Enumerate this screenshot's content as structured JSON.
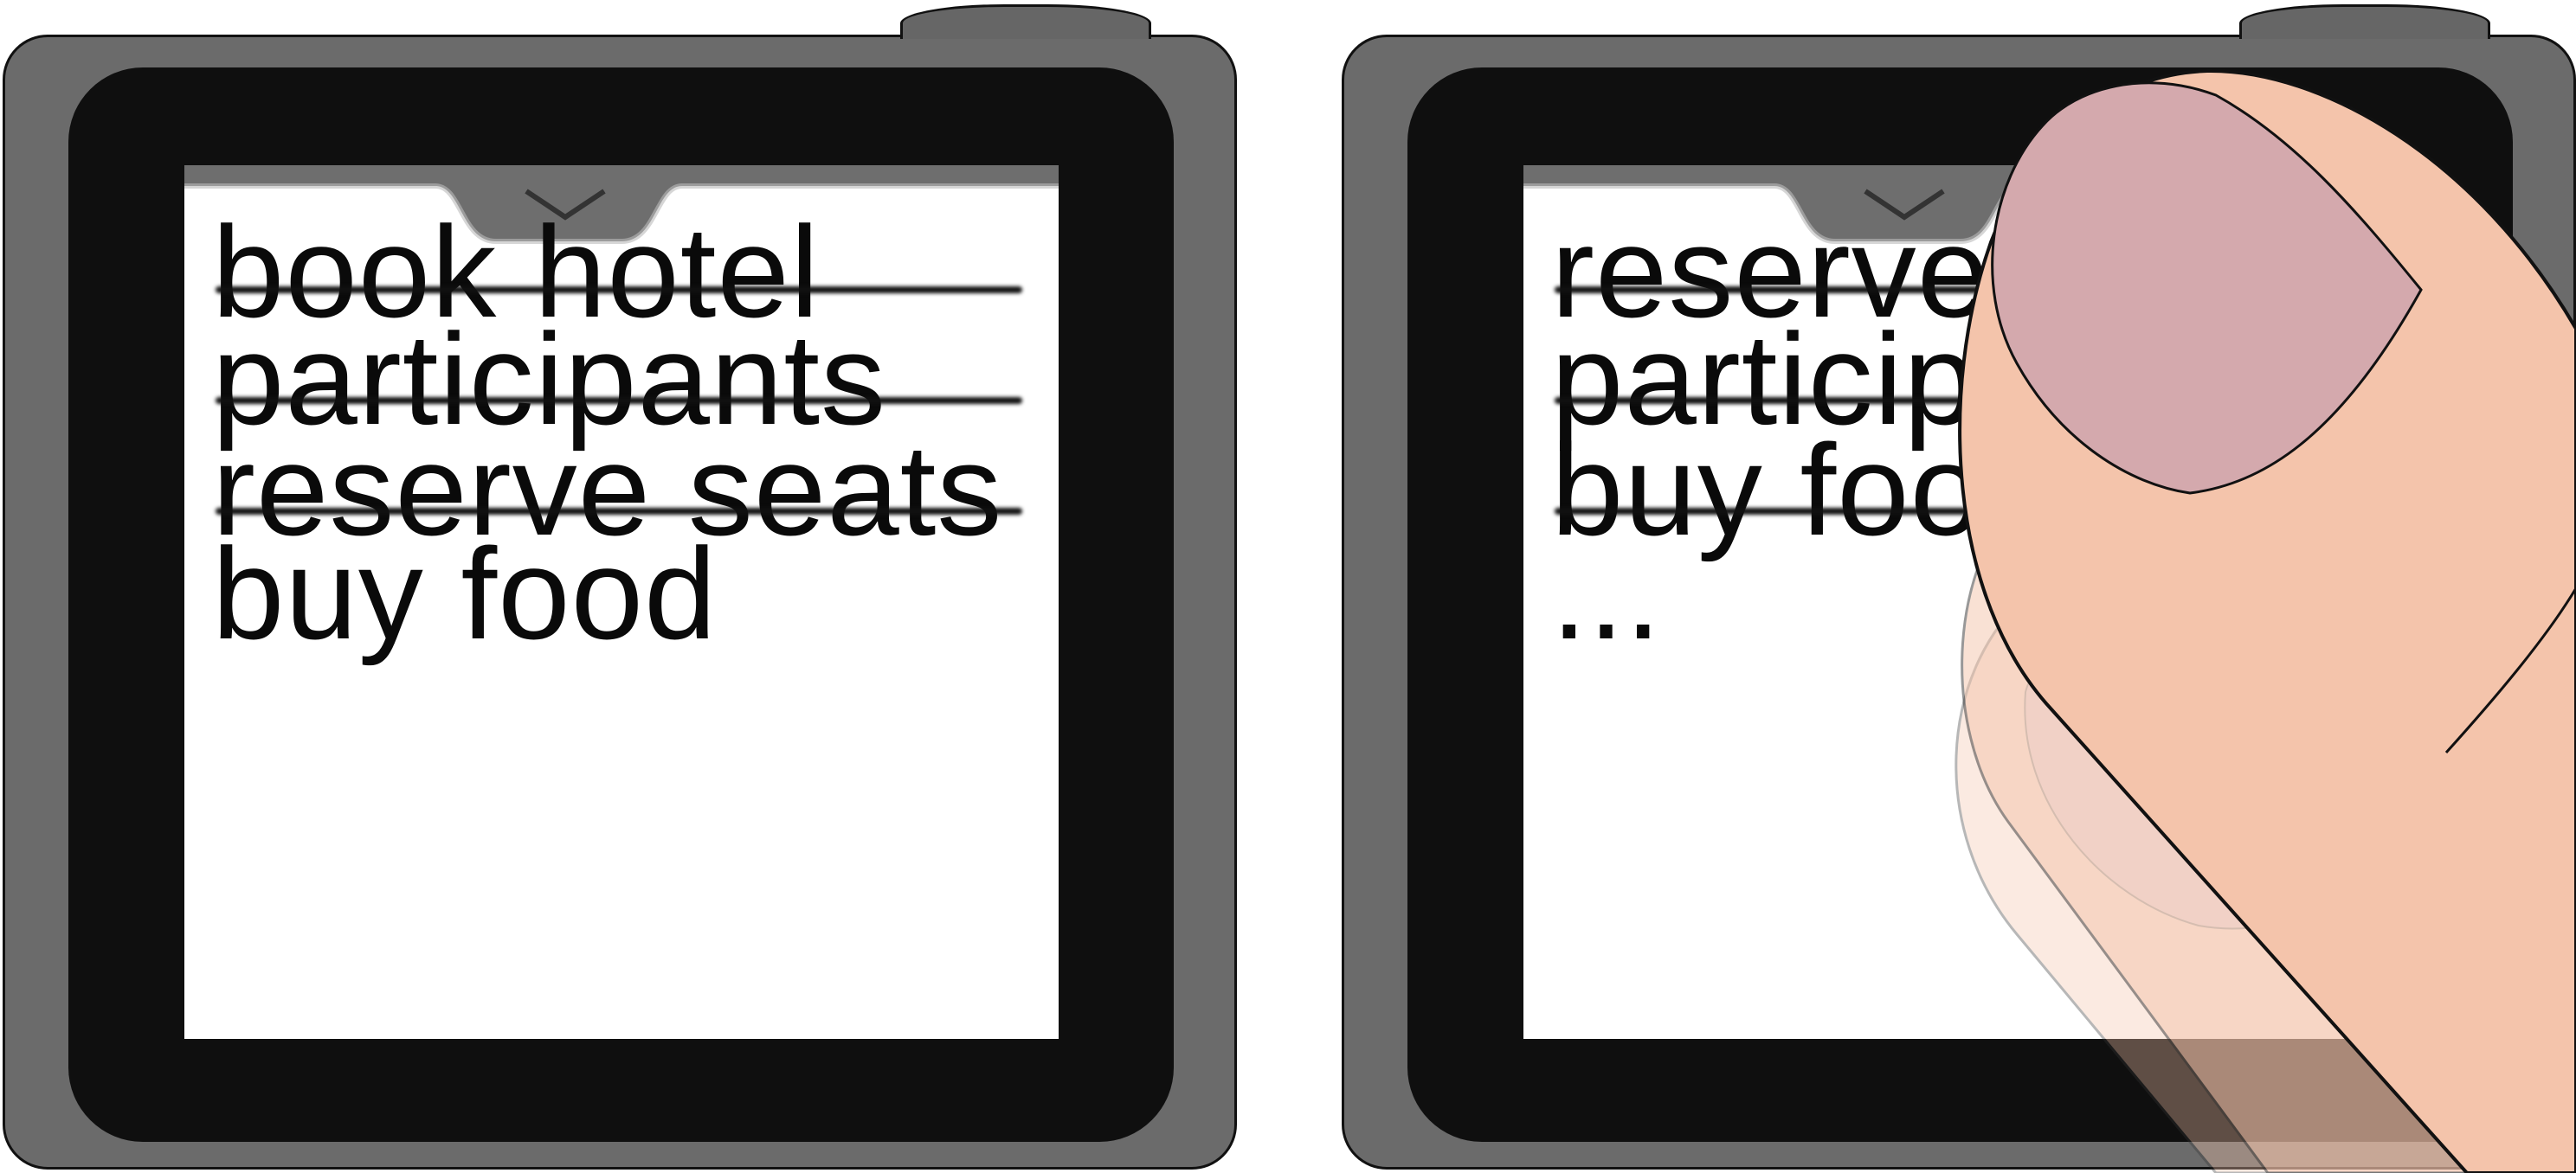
{
  "devices": [
    {
      "items": [
        {
          "label": "book hotel"
        },
        {
          "label": "participants"
        },
        {
          "label": "reserve seats"
        },
        {
          "label": "buy food"
        }
      ]
    },
    {
      "items": [
        {
          "label": "reserve seats"
        },
        {
          "label": "participants"
        },
        {
          "label": "buy food"
        },
        {
          "label": "..."
        }
      ]
    }
  ],
  "icons": {
    "pull_down": "chevron-down-icon",
    "finger": "finger-icon"
  },
  "colors": {
    "device_body": "#6b6b6b",
    "bezel": "#0f0f0f",
    "screen": "#ffffff",
    "skin": "#f4c4ab",
    "nail": "#d4a9ad"
  }
}
